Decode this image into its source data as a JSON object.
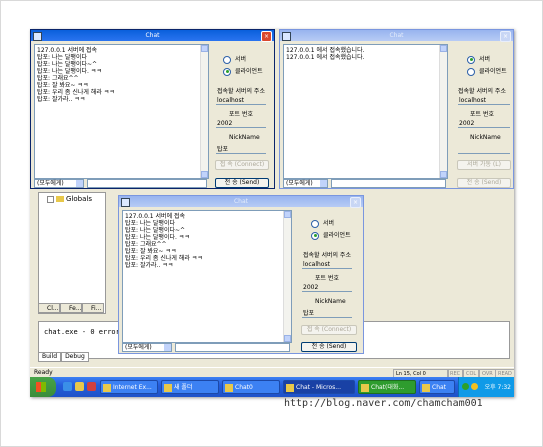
{
  "watermark": "http://blog.naver.com/chamcham001",
  "ide": {
    "tree_item": "Globals",
    "project_tabs": [
      "Cl...",
      "Fe...",
      "Fi..."
    ],
    "output_line": "chat.exe - 0 error(s)",
    "output_tabs": [
      "Build",
      "Debug"
    ],
    "status_ready": "Ready",
    "status_pos": "Ln 15, Col 0",
    "status_cells": [
      "REC",
      "COL",
      "OVR",
      "READ"
    ]
  },
  "taskbar": {
    "buttons": [
      "Internet Ex...",
      "새 폴더",
      "Chat0",
      "Chat - Micros...",
      "Chat(대화...",
      "Chat"
    ],
    "clock": "오후 7:32"
  },
  "client1": {
    "title": "Chat",
    "log": [
      "127.0.0.1 서버에 접속",
      "탑포: 나는 달팽이다",
      "탑포: 나는 달팽이다~^",
      "탑포: 나는 달팽이다. ㅋㅋ",
      "탑포: 그래요^^",
      "탑포: 잘 봐요~ ㅋㅋ",
      "탑포: 우리 좀 신나게 해라 ㅋㅋ",
      "탑포: 잘가라.. ㅋㅋ"
    ],
    "radio_server": "서버",
    "radio_client": "클라이언트",
    "addr_label": "접속할 서버의 주소",
    "addr_value": "localhost",
    "port_label": "포트 번호",
    "port_value": "2002",
    "nick_label": "NickName",
    "nick_value": "탑포",
    "connect_button": "접 속 (Connect)",
    "send_button": "전 송 (Send)",
    "combo": "(모두에게)"
  },
  "client2": {
    "title": "Chat",
    "log": [
      "127.0.0.1 에서 접속했습니다.",
      "127.0.0.1 에서 접속했습니다."
    ],
    "radio_server": "서버",
    "radio_client": "클라이언트",
    "addr_label": "접속할 서버의 주소",
    "addr_value": "localhost",
    "port_label": "포트 번호",
    "port_value": "2002",
    "nick_label": "NickName",
    "nick_value": "",
    "connect_button": "서버 가동 (L)",
    "send_button": "전 송 (Send)",
    "combo": "(모두에게)"
  },
  "client3": {
    "title": "Chat",
    "log": [
      "127.0.0.1 서버에 접속",
      "탑포: 나는 달팽이다",
      "탑포: 나는 달팽이다~^",
      "탑포: 나는 달팽이다. ㅋㅋ",
      "탑포: 그래요^^",
      "탑포: 잘 봐요~ ㅋㅋ",
      "탑포: 우리 좀 신나게 해라 ㅋㅋ",
      "탑포: 잘가라.. ㅋㅋ"
    ],
    "radio_server": "서버",
    "radio_client": "클라이언트",
    "addr_label": "접속할 서버의 주소",
    "addr_value": "localhost",
    "port_label": "포트 번호",
    "port_value": "2002",
    "nick_label": "NickName",
    "nick_value": "탑포",
    "connect_button": "접 속 (Connect)",
    "send_button": "전 송 (Send)",
    "combo": "(모두에게)"
  }
}
